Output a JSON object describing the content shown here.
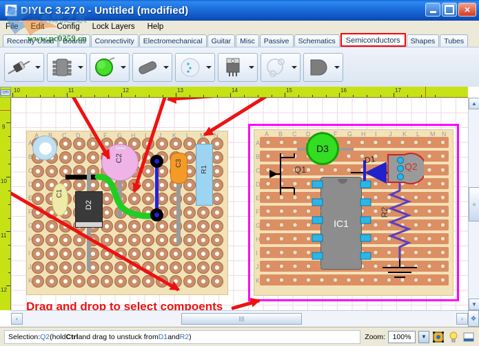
{
  "window": {
    "title": "DIYLC 3.27.0 - Untitled  (modified)",
    "app_icon": "diylc-app-icon",
    "minimize": "–",
    "maximize": "□",
    "close": "✕"
  },
  "watermark": {
    "url": "www.pc0359.cn"
  },
  "menu": {
    "items": [
      {
        "label": "File"
      },
      {
        "label": "Edit"
      },
      {
        "label": "Config"
      },
      {
        "label": "Lock Layers"
      },
      {
        "label": "Help"
      }
    ]
  },
  "tabs": {
    "selected": "Semiconductors",
    "items": [
      {
        "label": "Recently Used",
        "selected": false
      },
      {
        "label": "Boards",
        "selected": false
      },
      {
        "label": "Connectivity",
        "selected": false
      },
      {
        "label": "Electromechanical",
        "selected": false
      },
      {
        "label": "Guitar",
        "selected": false
      },
      {
        "label": "Misc",
        "selected": false
      },
      {
        "label": "Passive",
        "selected": false
      },
      {
        "label": "Schematics",
        "selected": false
      },
      {
        "label": "Semiconductors",
        "selected": true
      },
      {
        "label": "Shapes",
        "selected": false
      },
      {
        "label": "Tubes",
        "selected": false
      }
    ]
  },
  "toolbar": {
    "buttons": [
      {
        "icon": "diode-axial-icon",
        "dropdown": "chevron-down-icon"
      },
      {
        "icon": "dip-ic-icon",
        "dropdown": "chevron-down-icon"
      },
      {
        "icon": "led-green-icon",
        "dropdown": "chevron-down-icon"
      },
      {
        "icon": "transistor-axial-icon",
        "dropdown": "chevron-down-icon"
      },
      {
        "icon": "transistor-to5-icon",
        "dropdown": "chevron-down-icon"
      },
      {
        "icon": "transistor-to220-icon",
        "dropdown": "chevron-down-icon"
      },
      {
        "icon": "transistor-outline-icon",
        "dropdown": "chevron-down-icon"
      },
      {
        "icon": "transistor-to92-icon",
        "dropdown": "chevron-down-icon"
      }
    ]
  },
  "rulers": {
    "unit": "cm",
    "horizontal_ticks": [
      "10",
      "11",
      "12",
      "13",
      "14",
      "15",
      "16",
      "17"
    ],
    "vertical_ticks": [
      "9",
      "10",
      "11",
      "12"
    ]
  },
  "canvas": {
    "perfboard": {
      "name": "perfboard",
      "column_labels": [
        "A",
        "B",
        "C",
        "D",
        "E",
        "F",
        "G",
        "H",
        "I",
        "J",
        "K",
        "L",
        "M",
        "N"
      ],
      "row_labels": [
        "A",
        "B",
        "C",
        "D",
        "E",
        "F",
        "G",
        "H",
        "I",
        "J",
        "K"
      ],
      "components": [
        {
          "id": "C1",
          "type": "capacitor-electrolytic",
          "color": "#f0eaa8"
        },
        {
          "id": "C2",
          "type": "capacitor-film",
          "color": "#efb3e8"
        },
        {
          "id": "C3",
          "type": "capacitor-tantalum",
          "color": "#f59a27"
        },
        {
          "id": "R1",
          "type": "resistor",
          "color": "#9dd4f0"
        },
        {
          "id": "D2",
          "type": "diode-axial",
          "color": "#3a3a3a"
        }
      ],
      "wires": [
        {
          "name": "green-wire",
          "color": "#22cc22"
        },
        {
          "name": "blue-wire",
          "color": "#2222dd"
        },
        {
          "name": "black-trace",
          "color": "#000000"
        }
      ]
    },
    "stripboard": {
      "name": "stripboard",
      "column_labels": [
        "A",
        "B",
        "C",
        "D",
        "E",
        "F",
        "G",
        "H",
        "I",
        "J",
        "K",
        "L",
        "M",
        "N"
      ],
      "row_labels": [
        "A",
        "B",
        "C",
        "D",
        "E",
        "F",
        "G",
        "H",
        "I",
        "J",
        "K"
      ],
      "components": [
        {
          "id": "D3",
          "type": "led",
          "color": "#33dd22"
        },
        {
          "id": "Q1",
          "type": "mosfet-symbol",
          "color": "#000000"
        },
        {
          "id": "IC1",
          "type": "dip-ic",
          "color": "#8d8d8d"
        },
        {
          "id": "D1",
          "type": "diode-symbol",
          "color": "#2222cc"
        },
        {
          "id": "Q2",
          "type": "transistor-to92",
          "color": "#9a9a9a",
          "selected": true
        },
        {
          "id": "R2",
          "type": "resistor-symbol",
          "color": "#5b3fbf"
        },
        {
          "id": "GND",
          "type": "ground-symbol",
          "color": "#000000"
        }
      ],
      "selection_color": "#ff00ff"
    },
    "annotation": {
      "text": "Drag and drop to select compoents",
      "color": "#ee1111"
    }
  },
  "scrollbars": {
    "left_arrow": "‹",
    "right_arrow": "›",
    "up_arrow": "▲",
    "down_arrow": "▼",
    "corner": "✥"
  },
  "statusbar": {
    "prefix": "Selection: ",
    "selection": "Q2",
    "mid1": " (hold ",
    "key": "Ctrl",
    "mid2": " and drag to unstuck from ",
    "ref1": "D1",
    "mid3": " and ",
    "ref2": "R2",
    "suffix": ")",
    "zoom_label": "Zoom:",
    "zoom_value": "100%",
    "zoom_dropdown": "chevron-down-icon",
    "icons": [
      {
        "name": "selection-frame-icon"
      },
      {
        "name": "lightbulb-icon"
      },
      {
        "name": "panel-icon"
      }
    ]
  }
}
